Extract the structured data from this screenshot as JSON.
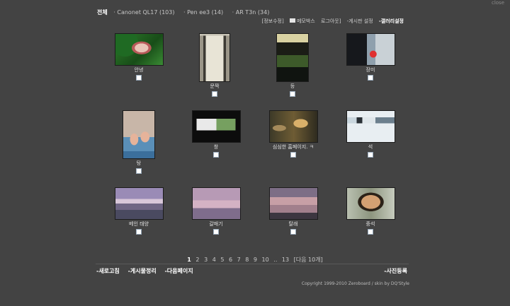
{
  "window": {
    "close_label": "close"
  },
  "categories": {
    "all_label": "전체",
    "items": [
      "· Canonet QL17 (103)",
      "· Pen ee3 (14)",
      "· AR T3n (34)"
    ]
  },
  "top_links": {
    "info": "[정보수정]",
    "memo": "메모박스",
    "logout": "로그아웃]",
    "board_settings": "-게시판 설정",
    "gallery_settings": "-갤러리설정"
  },
  "photos": [
    {
      "caption": "안녕"
    },
    {
      "caption": "문짝"
    },
    {
      "caption": "등"
    },
    {
      "caption": "장미"
    },
    {
      "caption": "탕"
    },
    {
      "caption": "창"
    },
    {
      "caption": "심심한 홈페이지. ㅋ"
    },
    {
      "caption": "석"
    },
    {
      "caption": "베인 태양"
    },
    {
      "caption": "갈매기"
    },
    {
      "caption": "탈래"
    },
    {
      "caption": "중석"
    }
  ],
  "pagination": {
    "pages": [
      "1",
      "2",
      "3",
      "4",
      "5",
      "6",
      "7",
      "8",
      "9",
      "10",
      "..",
      "13"
    ],
    "current": "1",
    "next_label": "[다음 10개]"
  },
  "bottom_links": {
    "refresh": "-새로고침",
    "manage": "-게시물정리",
    "next_page": "-다음페이지",
    "register": "-사진등록"
  },
  "copyright": "Copyright 1999-2010 Zeroboard / skin by DQ'Style"
}
